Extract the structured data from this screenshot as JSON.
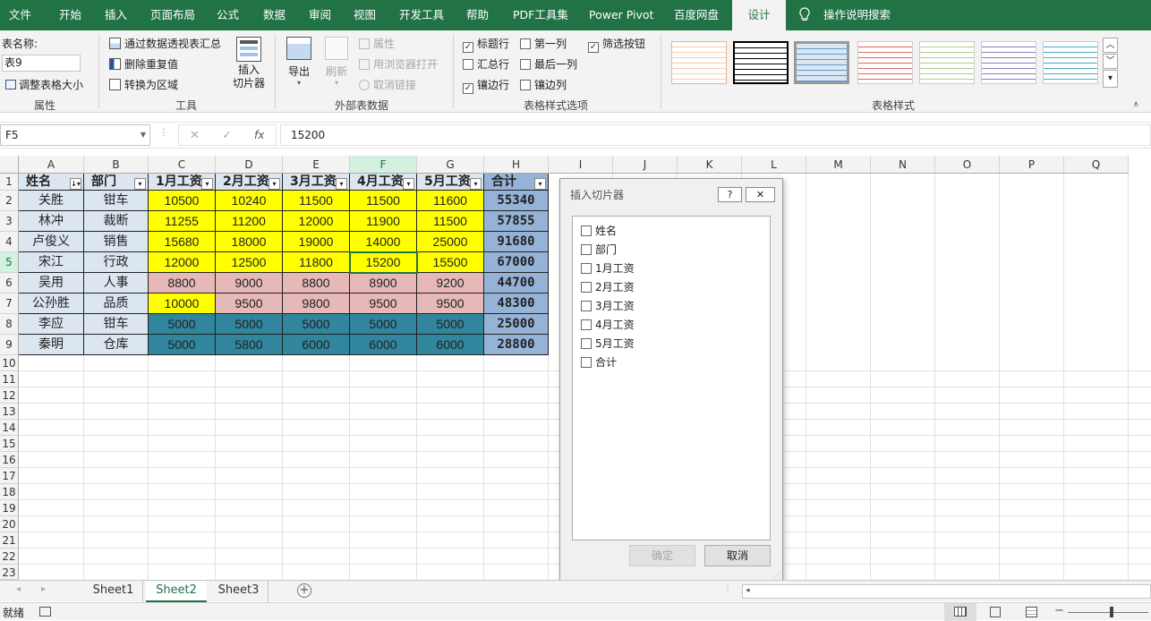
{
  "tabs": [
    "文件",
    "开始",
    "插入",
    "页面布局",
    "公式",
    "数据",
    "审阅",
    "视图",
    "开发工具",
    "帮助",
    "PDF工具集",
    "Power Pivot",
    "百度网盘",
    "设计",
    "操作说明搜索"
  ],
  "ribbon": {
    "table_name_label": "表名称:",
    "table_name_value": "表9",
    "resize_label": "调整表格大小",
    "group_properties": "属性",
    "pivot_label": "通过数据透视表汇总",
    "remove_dup_label": "删除重复值",
    "convert_label": "转换为区域",
    "slicer_label1": "插入",
    "slicer_label2": "切片器",
    "group_tools": "工具",
    "export_label": "导出",
    "refresh_label": "刷新",
    "prop_label": "属性",
    "browser_label": "用浏览器打开",
    "unlink_label": "取消链接",
    "group_external": "外部表数据",
    "header_row": "标题行",
    "total_row": "汇总行",
    "banded_rows": "镶边行",
    "first_col": "第一列",
    "last_col": "最后一列",
    "banded_cols": "镶边列",
    "filter_btn": "筛选按钮",
    "group_style_opts": "表格样式选项",
    "group_styles": "表格样式",
    "checked_mark": "✓"
  },
  "formula": {
    "namebox": "F5",
    "cancel": "✕",
    "enter": "✓",
    "fx": "fx",
    "value": "15200"
  },
  "col_letters": [
    "A",
    "B",
    "C",
    "D",
    "E",
    "F",
    "G",
    "H",
    "I",
    "J",
    "K",
    "L",
    "M",
    "N",
    "O",
    "P",
    "Q"
  ],
  "row_numbers": [
    "1",
    "2",
    "3",
    "4",
    "5",
    "6",
    "7",
    "8",
    "9",
    "10",
    "11",
    "12",
    "13",
    "14",
    "15",
    "16",
    "17",
    "18",
    "19",
    "20",
    "21",
    "22",
    "23"
  ],
  "table": {
    "headers": [
      "姓名",
      "部门",
      "1月工资",
      "2月工资",
      "3月工资",
      "4月工资",
      "5月工资",
      "合计"
    ],
    "rows": [
      [
        "关胜",
        "钳车",
        "10500",
        "10240",
        "11500",
        "11500",
        "11600",
        "55340"
      ],
      [
        "林冲",
        "裁断",
        "11255",
        "11200",
        "12000",
        "11900",
        "11500",
        "57855"
      ],
      [
        "卢俊义",
        "销售",
        "15680",
        "18000",
        "19000",
        "14000",
        "25000",
        "91680"
      ],
      [
        "宋江",
        "行政",
        "12000",
        "12500",
        "11800",
        "15200",
        "15500",
        "67000"
      ],
      [
        "吴用",
        "人事",
        "8800",
        "9000",
        "8800",
        "8900",
        "9200",
        "44700"
      ],
      [
        "公孙胜",
        "品质",
        "10000",
        "9500",
        "9800",
        "9500",
        "9500",
        "48300"
      ],
      [
        "李应",
        "钳车",
        "5000",
        "5000",
        "5000",
        "5000",
        "5000",
        "25000"
      ],
      [
        "秦明",
        "仓库",
        "5000",
        "5800",
        "6000",
        "6000",
        "6000",
        "28800"
      ]
    ]
  },
  "colors": {
    "yellow": "#ffff00",
    "pink": "#e6b8b7",
    "teal": "#31859c",
    "blue": "#95b3d7",
    "light": "#dce6f1",
    "green": "#217346"
  },
  "dialog": {
    "title": "插入切片器",
    "help": "?",
    "close": "✕",
    "items": [
      "姓名",
      "部门",
      "1月工资",
      "2月工资",
      "3月工资",
      "4月工资",
      "5月工资",
      "合计"
    ],
    "ok": "确定",
    "cancel": "取消"
  },
  "sheets": [
    "Sheet1",
    "Sheet2",
    "Sheet3"
  ],
  "active_sheet": "Sheet2",
  "status": {
    "ready": "就绪"
  }
}
